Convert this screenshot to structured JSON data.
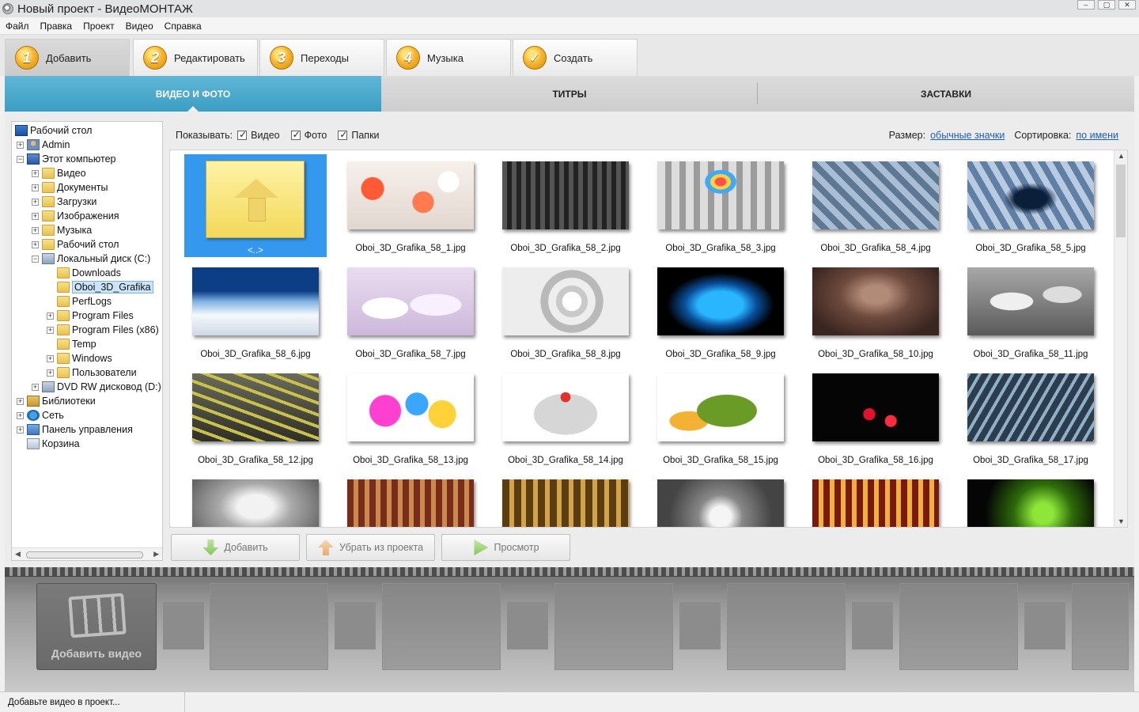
{
  "window": {
    "title": "Новый проект - ВидеоМОНТАЖ"
  },
  "menu": [
    "Файл",
    "Правка",
    "Проект",
    "Видео",
    "Справка"
  ],
  "steps": [
    {
      "num": "1",
      "label": "Добавить",
      "active": true
    },
    {
      "num": "2",
      "label": "Редактировать"
    },
    {
      "num": "3",
      "label": "Переходы"
    },
    {
      "num": "4",
      "label": "Музыка"
    },
    {
      "num": "✓",
      "label": "Создать"
    }
  ],
  "subtabs": [
    "ВИДЕО И ФОТО",
    "ТИТРЫ",
    "ЗАСТАВКИ"
  ],
  "tree": [
    {
      "label": "Рабочий стол",
      "icon": "desktop-icon",
      "level": 0,
      "exp": ""
    },
    {
      "label": "Admin",
      "icon": "user-icon",
      "level": 1,
      "exp": "+"
    },
    {
      "label": "Этот компьютер",
      "icon": "pc-icon",
      "level": 1,
      "exp": "−"
    },
    {
      "label": "Видео",
      "icon": "folder-icon",
      "level": 2,
      "exp": "+"
    },
    {
      "label": "Документы",
      "icon": "folder-icon",
      "level": 2,
      "exp": "+"
    },
    {
      "label": "Загрузки",
      "icon": "folder-icon",
      "level": 2,
      "exp": "+"
    },
    {
      "label": "Изображения",
      "icon": "folder-icon",
      "level": 2,
      "exp": "+"
    },
    {
      "label": "Музыка",
      "icon": "folder-icon",
      "level": 2,
      "exp": "+"
    },
    {
      "label": "Рабочий стол",
      "icon": "folder-icon",
      "level": 2,
      "exp": "+"
    },
    {
      "label": "Локальный диск (C:)",
      "icon": "drive-icon",
      "level": 2,
      "exp": "−"
    },
    {
      "label": "Downloads",
      "icon": "folder-icon",
      "level": 3,
      "exp": ""
    },
    {
      "label": "Oboi_3D_Grafika",
      "icon": "folder-icon",
      "level": 3,
      "exp": "",
      "selected": true
    },
    {
      "label": "PerfLogs",
      "icon": "folder-icon",
      "level": 3,
      "exp": ""
    },
    {
      "label": "Program Files",
      "icon": "folder-icon",
      "level": 3,
      "exp": "+"
    },
    {
      "label": "Program Files (x86)",
      "icon": "folder-icon",
      "level": 3,
      "exp": "+"
    },
    {
      "label": "Temp",
      "icon": "folder-icon",
      "level": 3,
      "exp": ""
    },
    {
      "label": "Windows",
      "icon": "folder-icon",
      "level": 3,
      "exp": "+"
    },
    {
      "label": "Пользователи",
      "icon": "folder-icon",
      "level": 3,
      "exp": "+"
    },
    {
      "label": "DVD RW дисковод (D:)",
      "icon": "drive-icon",
      "level": 2,
      "exp": "+"
    },
    {
      "label": "Библиотеки",
      "icon": "libraries-icon",
      "level": 1,
      "exp": "+"
    },
    {
      "label": "Сеть",
      "icon": "network-icon",
      "level": 1,
      "exp": "+"
    },
    {
      "label": "Панель управления",
      "icon": "control-panel-icon",
      "level": 1,
      "exp": "+"
    },
    {
      "label": "Корзина",
      "icon": "trash-icon",
      "level": 1,
      "exp": ""
    }
  ],
  "filter": {
    "show_label": "Показывать:",
    "video": "Видео",
    "photo": "Фото",
    "folders": "Папки",
    "size_label": "Размер:",
    "size_value": "обычные значки",
    "sort_label": "Сортировка:",
    "sort_value": "по имени"
  },
  "files": [
    {
      "name": "<..>",
      "up": true
    },
    {
      "name": "Oboi_3D_Grafika_58_1.jpg",
      "bg": "radial-gradient(circle at 20% 40%, #ff5a36 0 10%, transparent 11%), radial-gradient(circle at 60% 60%, #ff7a50 0 12%, transparent 13%), radial-gradient(circle at 80% 30%, #fff 0 9%, transparent 10%), linear-gradient(#f7f0ea, #e1d7d0)"
    },
    {
      "name": "Oboi_3D_Grafika_58_2.jpg",
      "bg": "repeating-linear-gradient(90deg, #555 0 6px, #222 6px 12px), #222"
    },
    {
      "name": "Oboi_3D_Grafika_58_3.jpg",
      "bg": "radial-gradient(ellipse at 50% 30%, #ff4f4f 0 6%, #ffd23c 7% 11%, #3fa9f5 12% 17%, transparent 18%), repeating-linear-gradient(90deg, #ddd 0 10px, #9b9b9b 10px 18px)"
    },
    {
      "name": "Oboi_3D_Grafika_58_4.jpg",
      "bg": "repeating-linear-gradient(45deg, #a9bed4 0 8px, #5e7893 8px 16px)"
    },
    {
      "name": "Oboi_3D_Grafika_58_5.jpg",
      "bg": "radial-gradient(ellipse at 50% 55%, #0b1f3a 0 18%, transparent 30%), repeating-linear-gradient(60deg, #b8cbe0 0 8px, #5f7fa4 8px 16px)"
    },
    {
      "name": "Oboi_3D_Grafika_58_6.jpg",
      "bg": "linear-gradient(#0c3e86 0 35%, #7fb2e3 50%, #f5f8fc 70%, #cfd9e6 100%)"
    },
    {
      "name": "Oboi_3D_Grafika_58_7.jpg",
      "bg": "radial-gradient(ellipse at 30% 60%, #fff 0 18%, transparent 19%), radial-gradient(ellipse at 70% 55%, #f9f0ff 0 20%, transparent 21%), linear-gradient(#e9dcf0, #cdb8da)"
    },
    {
      "name": "Oboi_3D_Grafika_58_8.jpg",
      "bg": "radial-gradient(circle at 55% 50%, #fff 0 12%, #c9c9c9 13% 20%, #eee 21% 30%, #b9b9b9 31% 40%, #ededed 41%)"
    },
    {
      "name": "Oboi_3D_Grafika_58_9.jpg",
      "bg": "radial-gradient(ellipse at 50% 55%, #2ab6ff 0 25%, #0a4f9c 40%, #000 60%)"
    },
    {
      "name": "Oboi_3D_Grafika_58_10.jpg",
      "bg": "radial-gradient(ellipse at 50% 40%, #b28a78 0 15%, #6d4a3d 40%, #3a2620 80%)"
    },
    {
      "name": "Oboi_3D_Grafika_58_11.jpg",
      "bg": "radial-gradient(ellipse at 35% 50%, #efefef 0 18%, transparent 19%), radial-gradient(ellipse at 75% 40%, #ddd 0 14%, transparent 15%), linear-gradient(#a8a8a8, #5a5a5a)"
    },
    {
      "name": "Oboi_3D_Grafika_58_12.jpg",
      "bg": "repeating-linear-gradient(20deg, #c9c14a 0 4px, transparent 4px 14px), linear-gradient(#6b6b5a, #2f2f28)"
    },
    {
      "name": "Oboi_3D_Grafika_58_13.jpg",
      "bg": "radial-gradient(circle at 30% 55%, #ff3fd0 0 16%, transparent 17%), radial-gradient(circle at 55% 45%, #3aa6ff 0 14%, transparent 15%), radial-gradient(circle at 75% 60%, #ffd23a 0 13%, transparent 14%), #fff"
    },
    {
      "name": "Oboi_3D_Grafika_58_14.jpg",
      "bg": "radial-gradient(circle at 50% 35%, #e1322a 0 6%, transparent 7%), radial-gradient(ellipse at 50% 60%, #d6d6d6 0 35%, transparent 36%), #fff"
    },
    {
      "name": "Oboi_3D_Grafika_58_15.jpg",
      "bg": "radial-gradient(ellipse at 55% 55%, #6b9b27 0 30%, transparent 31%), radial-gradient(ellipse at 25% 70%, #f3b234 0 14%, transparent 15%), #fff"
    },
    {
      "name": "Oboi_3D_Grafika_58_16.jpg",
      "bg": "radial-gradient(circle at 45% 60%, #e1122a 0 7%, transparent 8%), radial-gradient(circle at 62% 70%, #ff2b3e 0 6%, transparent 7%), #050505"
    },
    {
      "name": "Oboi_3D_Grafika_58_17.jpg",
      "bg": "repeating-linear-gradient(120deg, #8fb0c6 0 4px, #2c3e4d 4px 12px)"
    },
    {
      "name": "",
      "bg": "radial-gradient(ellipse at 50% 40%, #f2f2f2 0 20%, #aaa 40%, #666 80%)"
    },
    {
      "name": "",
      "bg": "repeating-linear-gradient(90deg, #7a2c1b 0 8px, #c98a4f 8px 14px)"
    },
    {
      "name": "",
      "bg": "repeating-linear-gradient(90deg, #5c3d0f 0 9px, #d1a34a 9px 15px)"
    },
    {
      "name": "",
      "bg": "radial-gradient(circle at 50% 55%, #f5f5f5 0 14%, #888 30%, #444 70%)"
    },
    {
      "name": "",
      "bg": "repeating-linear-gradient(90deg, #7a1a0f 0 8px, #f0b13a 8px 14px)"
    },
    {
      "name": "",
      "bg": "radial-gradient(circle at 60% 50%, #8ee63a 0 12%, #2e6b0a 35%, #050505 70%)"
    }
  ],
  "actions": {
    "add": "Добавить",
    "remove": "Убрать из проекта",
    "preview": "Просмотр"
  },
  "timeline": {
    "add_video": "Добавить видео"
  },
  "status": {
    "message": "Добавьте видео в проект..."
  }
}
